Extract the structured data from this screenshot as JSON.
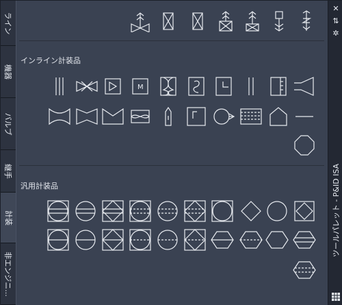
{
  "tabs": [
    {
      "label": "ライン",
      "active": false
    },
    {
      "label": "機器",
      "active": false
    },
    {
      "label": "バルブ",
      "active": false
    },
    {
      "label": "継手",
      "active": false
    },
    {
      "label": "計装",
      "active": true
    },
    {
      "label": "非エンジニ...",
      "active": false
    }
  ],
  "sections": {
    "inline": {
      "title": "インライン計装品"
    },
    "general": {
      "title": "汎用計装品"
    }
  },
  "palette": {
    "title": "ツールパレット - P&ID ISA"
  },
  "icons": {
    "close": "close-icon",
    "autohide": "autohide-icon",
    "properties": "gear-icon",
    "menu": "palette-menu-icon"
  },
  "inline_m_label": "M",
  "colors": {
    "panel": "#3a4252",
    "stroke": "#e8ebf0",
    "tab_active": "#3f4757"
  }
}
